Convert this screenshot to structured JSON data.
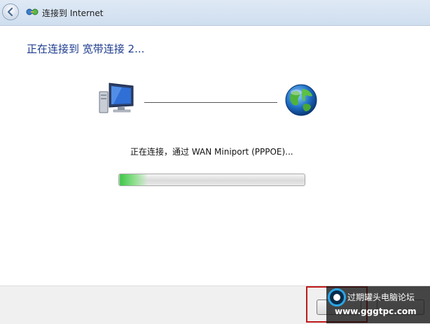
{
  "window": {
    "title": "连接到 Internet"
  },
  "main": {
    "heading": "正在连接到 宽带连接 2...",
    "status": "正在连接，通过 WAN Miniport (PPPOE)...",
    "progress_fraction": 0.15
  },
  "icons": {
    "back": "back-arrow-icon",
    "network": "network-connections-icon",
    "computer": "computer-icon",
    "globe": "globe-icon"
  },
  "watermark": {
    "title": "过期罐头电脑论坛",
    "url": "www.gggtpc.com"
  }
}
